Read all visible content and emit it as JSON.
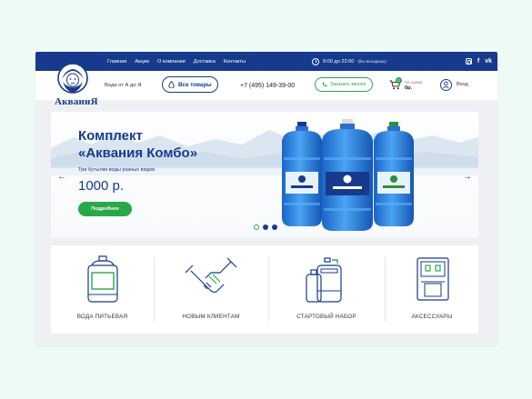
{
  "nav": {
    "items": [
      "Главная",
      "Акции",
      "О компании",
      "Доставка",
      "Контакты"
    ]
  },
  "schedule": {
    "hours": "9:00 до 22:00",
    "note": "(без выходных)"
  },
  "social": {
    "fb": "f",
    "vk": "vk"
  },
  "brand": {
    "logo_text": "АкваниЯ",
    "tagline": "Вода от А до Я"
  },
  "header": {
    "all_products": "Все товары",
    "phone": "+7 (495) 149-39-00",
    "callback": "Заказать звонок",
    "cart_label": "На сумму",
    "cart_sum": "0р.",
    "cart_count": "0",
    "login": "Вход"
  },
  "hero": {
    "title_line1": "Комплект",
    "title_line2": "«Аквания Комбо»",
    "subtitle": "Три бутылки воды разных видов",
    "price": "1000 р.",
    "button": "Подробнее",
    "slides_total": 3,
    "active_slide": 1,
    "prev_arrow": "←",
    "next_arrow": "→",
    "bottle_label": "Аквания"
  },
  "categories": [
    {
      "label": "ВОДА ПИТЬЕВАЯ",
      "icon": "water-bottle-icon"
    },
    {
      "label": "НОВЫМ КЛИЕНТАМ",
      "icon": "handshake-icon"
    },
    {
      "label": "СТАРТОВЫЙ НАБОР",
      "icon": "starter-kit-icon"
    },
    {
      "label": "АКСЕССУАРЫ",
      "icon": "water-cooler-icon"
    }
  ],
  "colors": {
    "primary": "#173a8d",
    "accent": "#29a84a",
    "bottle": "#2a7de1"
  }
}
